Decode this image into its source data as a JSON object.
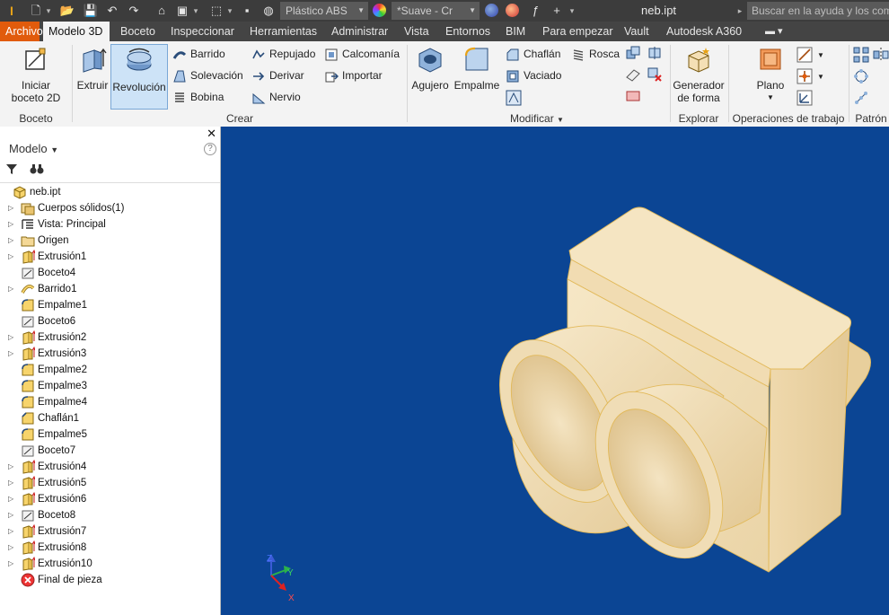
{
  "titlebar": {
    "material": "Plástico ABS",
    "appearance": "*Suave - Cr",
    "doc_title": "neb.ipt",
    "help_search_placeholder": "Buscar en la ayuda y los comandos"
  },
  "tabs": [
    "Archivo",
    "Modelo 3D",
    "Boceto",
    "Inspeccionar",
    "Herramientas",
    "Administrar",
    "Vista",
    "Entornos",
    "BIM",
    "Para empezar",
    "Vault",
    "Autodesk A360"
  ],
  "ribbon": {
    "sketch": {
      "button": "Iniciar boceto 2D",
      "line1": "Iniciar",
      "line2": "boceto 2D",
      "panel": "Boceto"
    },
    "create": {
      "panel": "Crear",
      "extrude": "Extruir",
      "revolve": "Revolución",
      "sweep": "Barrido",
      "loft": "Solevación",
      "coil": "Bobina",
      "emboss": "Repujado",
      "derive": "Derivar",
      "rib": "Nervio",
      "decal": "Calcomanía",
      "import": "Importar"
    },
    "modify": {
      "panel": "Modificar",
      "hole": "Agujero",
      "fillet": "Empalme",
      "chamfer": "Chaflán",
      "shell": "Vaciado",
      "thread": "Rosca"
    },
    "explore": {
      "panel": "Explorar",
      "line1": "Generador",
      "line2": "de forma"
    },
    "workfeatures": {
      "panel": "Operaciones de trabajo",
      "plane": "Plano"
    },
    "pattern": {
      "panel": "Patrón"
    }
  },
  "browser": {
    "title": "Modelo",
    "tree": [
      {
        "label": "neb.ipt",
        "icon": "part-icon",
        "expandable": false,
        "root": true
      },
      {
        "label": "Cuerpos sólidos(1)",
        "icon": "solid-bodies-icon",
        "expandable": true
      },
      {
        "label": "Vista: Principal",
        "icon": "view-icon",
        "expandable": true
      },
      {
        "label": "Origen",
        "icon": "folder-icon",
        "expandable": true
      },
      {
        "label": "Extrusión1",
        "icon": "extrude-icon",
        "expandable": true
      },
      {
        "label": "Boceto4",
        "icon": "sketch-icon",
        "expandable": false
      },
      {
        "label": "Barrido1",
        "icon": "sweep-icon",
        "expandable": true
      },
      {
        "label": "Empalme1",
        "icon": "fillet-icon",
        "expandable": false
      },
      {
        "label": "Boceto6",
        "icon": "sketch-icon",
        "expandable": false
      },
      {
        "label": "Extrusión2",
        "icon": "extrude-icon",
        "expandable": true
      },
      {
        "label": "Extrusión3",
        "icon": "extrude-icon",
        "expandable": true
      },
      {
        "label": "Empalme2",
        "icon": "fillet-icon",
        "expandable": false
      },
      {
        "label": "Empalme3",
        "icon": "fillet-icon",
        "expandable": false
      },
      {
        "label": "Empalme4",
        "icon": "fillet-icon",
        "expandable": false
      },
      {
        "label": "Chaflán1",
        "icon": "chamfer-icon",
        "expandable": false
      },
      {
        "label": "Empalme5",
        "icon": "fillet-icon",
        "expandable": false
      },
      {
        "label": "Boceto7",
        "icon": "sketch-icon",
        "expandable": false
      },
      {
        "label": "Extrusión4",
        "icon": "extrude-icon",
        "expandable": true
      },
      {
        "label": "Extrusión5",
        "icon": "extrude-icon",
        "expandable": true
      },
      {
        "label": "Extrusión6",
        "icon": "extrude-icon",
        "expandable": true
      },
      {
        "label": "Boceto8",
        "icon": "sketch-icon",
        "expandable": true
      },
      {
        "label": "Extrusión7",
        "icon": "extrude-icon",
        "expandable": true
      },
      {
        "label": "Extrusión8",
        "icon": "extrude-icon",
        "expandable": true
      },
      {
        "label": "Extrusión10",
        "icon": "extrude-icon",
        "expandable": true
      },
      {
        "label": "Final de pieza",
        "icon": "end-of-part-icon",
        "expandable": false
      }
    ]
  },
  "viewcube": {
    "x": "X",
    "y": "Y",
    "z": "Z"
  },
  "colors": {
    "accent": "#e15b0c",
    "viewport": "#0b4594",
    "selection": "#cde3f7",
    "part": "#f4dfb5"
  }
}
